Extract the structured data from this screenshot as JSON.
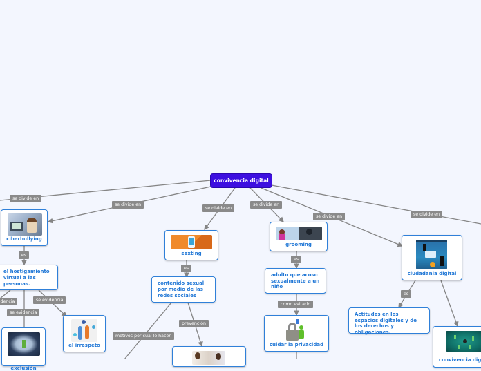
{
  "root": {
    "label": "convivencia digital"
  },
  "connector_labels": {
    "divide_1": "se divide en",
    "divide_2": "se divide en",
    "divide_3": "se divide en",
    "divide_4": "se divide en",
    "divide_5": "se divide en",
    "divide_6": "se divide en",
    "es_ciber": "es",
    "es_sexting": "es",
    "es_grooming": "es",
    "es_ciudadania": "es",
    "evidencia_1": "se evidencia",
    "evidencia_2": "se evidencia",
    "evidencia_3": "se evidencia",
    "motivos": "motivos por cual lo hacen",
    "prevencion": "prevención",
    "como_evitarlo": "como evitarlo"
  },
  "nodes": {
    "ciberbullying": {
      "label": "ciberbullying",
      "image": "person-stressed-at-computer"
    },
    "hostigamiento": {
      "label": "el hostigamiento virtual a las personas."
    },
    "irrespeto": {
      "label": "el irrespeto",
      "image": "figures-arguing-social-icons"
    },
    "exclusion": {
      "label": "exclusión",
      "image": "isolated-figure-crowd"
    },
    "sexting": {
      "label": "sexting",
      "image": "phone-selfie-orange"
    },
    "contenido": {
      "label": "contenido sexual por medio de las redes sociales"
    },
    "prevencion_node": {
      "label": "",
      "image": "people-talking"
    },
    "grooming": {
      "label": "grooming",
      "image": "child-and-stranger-online"
    },
    "adulto": {
      "label": "adulto que  acoso sexualmente a un niño"
    },
    "privacidad": {
      "label": "cuidar la privacidad",
      "image": "padlock-green-figure"
    },
    "ciudadania": {
      "label": "ciudadania digital",
      "image": "digital-citizens-infographic"
    },
    "actitudes": {
      "label": "Actitudes en los espacios digitales y de los derechos y obligaciones."
    },
    "convivencia2": {
      "label": "convivencia digital",
      "image": "network-people"
    }
  },
  "colors": {
    "root_bg": "#3d0fe0",
    "node_border": "#2f80d9",
    "node_text": "#2278d6",
    "label_bg": "#8a8a8a",
    "background": "#f3f6fe",
    "line": "#858585"
  }
}
